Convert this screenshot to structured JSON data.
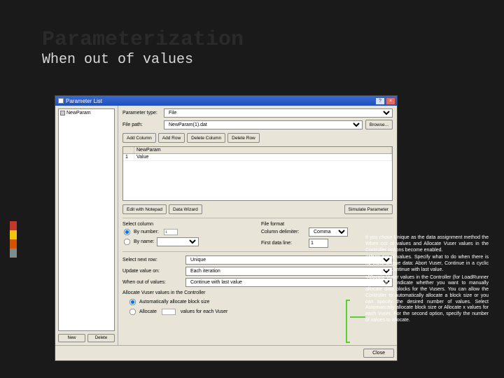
{
  "slide": {
    "title": "Parameterization",
    "subtitle": "When out of values"
  },
  "dialog": {
    "title": "Parameter List",
    "tree": {
      "item": "NewParam"
    },
    "left_buttons": {
      "new": "New",
      "delete": "Delete"
    },
    "param_type_label": "Parameter type:",
    "param_type_value": "File",
    "file_label": "File path:",
    "file_value": "NewParam(1).dat",
    "browse": "Browse...",
    "toolbar": {
      "add_column": "Add Column",
      "add_row": "Add Row",
      "delete_column": "Delete Column",
      "delete_row": "Delete Row"
    },
    "grid": {
      "header": "NewParam",
      "row1_idx": "1",
      "row1_val": "Value"
    },
    "edit_notepad": "Edit with Notepad",
    "data_wizard": "Data Wizard",
    "simulate": "Simulate Parameter",
    "select_column_label": "Select column",
    "by_number_label": "By number:",
    "by_number_value": "1",
    "by_name_label": "By name:",
    "file_format_label": "File format",
    "column_delim_label": "Column delimiter:",
    "column_delim_value": "Comma",
    "first_data_line_label": "First data line:",
    "first_data_line_value": "1",
    "select_next_label": "Select next row:",
    "select_next_value": "Unique",
    "update_value_label": "Update value on:",
    "update_value_value": "Each iteration",
    "when_out_label": "When out of values:",
    "when_out_value": "Continue with last value",
    "alloc_group": "Allocate Vuser values in the Controller",
    "alloc_auto": "Automatically allocate block size",
    "alloc_x": "Allocate",
    "alloc_x_suffix": "values for each Vuser",
    "close": "Close"
  },
  "note": {
    "p1": "If you chose Unique as the data assignment method the When out of values and Allocate Vuser values in the Controller options become enabled.",
    "p2": "•When out of values. Specify what to do when there is no more unique data: Abort Vuser, Continue in a cyclic manner, or Continue with last value.",
    "p3": "•Allocate Vuser values in the Controller (for LoadRunner users only). Indicate whether you want to manually allocate data blocks for the Vusers. You can allow the Controller to automatically allocate a block size or you can specify the desired number of values. Select Automatically allocate block size or Allocate x values for each Vuser. For the second option, specify the number of values to allocate."
  }
}
